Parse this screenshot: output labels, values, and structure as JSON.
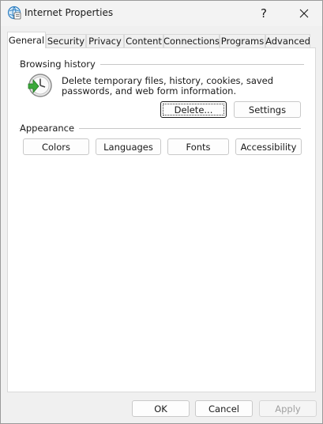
{
  "window": {
    "title": "Internet Properties",
    "help_glyph": "?",
    "close_glyph": "✕"
  },
  "tabs": [
    {
      "label": "General",
      "active": true
    },
    {
      "label": "Security"
    },
    {
      "label": "Privacy"
    },
    {
      "label": "Content"
    },
    {
      "label": "Connections"
    },
    {
      "label": "Programs"
    },
    {
      "label": "Advanced"
    }
  ],
  "browsing_history": {
    "group_label": "Browsing history",
    "description": "Delete temporary files, history, cookies, saved passwords, and web form information.",
    "delete_label": "Delete...",
    "settings_label": "Settings"
  },
  "appearance": {
    "group_label": "Appearance",
    "colors_label": "Colors",
    "languages_label": "Languages",
    "fonts_label": "Fonts",
    "accessibility_label": "Accessibility"
  },
  "footer": {
    "ok_label": "OK",
    "cancel_label": "Cancel",
    "apply_label": "Apply"
  },
  "colors": {
    "icon_green": "#3aa83a",
    "icon_globe": "#2f7fc1"
  }
}
